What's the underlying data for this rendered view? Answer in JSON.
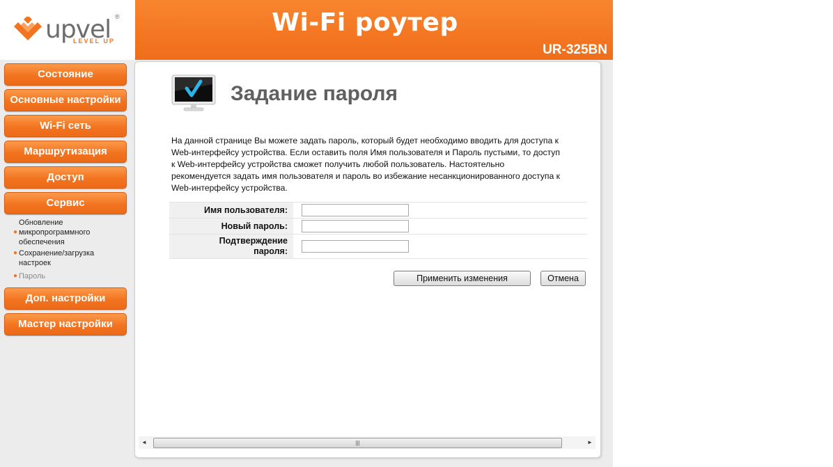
{
  "header": {
    "logo_text": "upvel",
    "logo_tagline": "LEVEL UP",
    "title": "Wi-Fi роутер",
    "model": "UR-325BN",
    "accent_color": "#f27420"
  },
  "sidebar": {
    "items": [
      {
        "label": "Состояние"
      },
      {
        "label": "Основные настройки"
      },
      {
        "label": "Wi-Fi сеть"
      },
      {
        "label": "Маршрутизация"
      },
      {
        "label": "Доступ"
      },
      {
        "label": "Сервис"
      },
      {
        "label": "Доп. настройки"
      },
      {
        "label": "Мастер настройки"
      }
    ],
    "service_subitems": [
      {
        "label_lines": [
          "Обновление",
          "микропрограммного",
          "обеспечения"
        ]
      },
      {
        "label_lines": [
          "Сохранение/загрузка",
          "настроек"
        ]
      },
      {
        "label": "Пароль",
        "active": true
      }
    ]
  },
  "main": {
    "page_title": "Задание пароля",
    "intro_lines": [
      "На данной странице Вы можете задать пароль, который будет необходимо вводить для доступа к",
      "Web-интерфейсу устройства. Если оставить поля Имя пользователя и Пароль пустыми, то доступ",
      "к Web-интерфейсу устройства сможет получить любой пользователь. Настоятельно",
      "рекомендуется задать имя пользователя и пароль во избежание несанкционированного доступа к",
      "Web-интерфейсу устройства."
    ],
    "form": {
      "username_label": "Имя пользователя:",
      "username_value": "",
      "new_password_label": "Новый пароль:",
      "new_password_value": "",
      "confirm_label_lines": [
        "Подтверждение",
        "пароля:"
      ],
      "confirm_value": ""
    },
    "buttons": {
      "apply": "Применить изменения",
      "cancel": "Отмена"
    }
  },
  "icons": {
    "logo": "upvel-logo-icon",
    "monitor": "monitor-checkmark-icon",
    "scroll_left": "scroll-left-arrow-icon",
    "scroll_right": "scroll-right-arrow-icon",
    "scroll_grip": "scroll-grip-icon"
  }
}
